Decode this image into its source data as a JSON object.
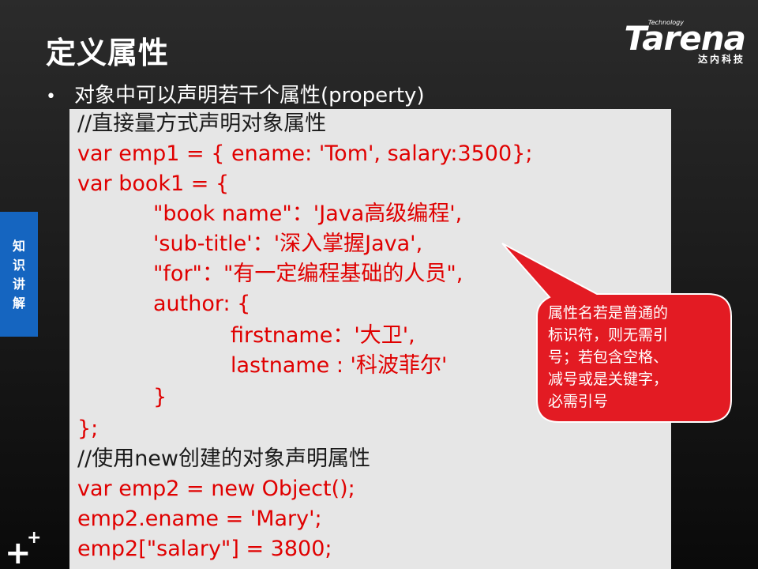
{
  "slide": {
    "title": "定义属性",
    "logo": {
      "tech": "Technology",
      "word": "Tarena",
      "cn": "达内科技"
    },
    "bullet": {
      "dot": "•",
      "text": "对象中可以声明若干个属性(property)"
    },
    "side_tab": [
      "知",
      "识",
      "讲",
      "解"
    ],
    "code_lines": [
      {
        "text": "//直接量方式声明对象属性",
        "kind": "comment"
      },
      {
        "text": "var emp1 = { ename: 'Tom',  salary:3500};",
        "kind": "code"
      },
      {
        "text": "var book1 = {",
        "kind": "code"
      },
      {
        "text": "\"book name\"：'Java高级编程',",
        "kind": "code"
      },
      {
        "text": "'sub-title'：'深入掌握Java',",
        "kind": "code"
      },
      {
        "text": "\"for\"：\"有一定编程基础的人员\",",
        "kind": "code"
      },
      {
        "text": "author: {",
        "kind": "code"
      },
      {
        "text": "firstname：'大卫',",
        "kind": "code"
      },
      {
        "text": "lastname : '科波菲尔'",
        "kind": "code"
      },
      {
        "text": "}",
        "kind": "code"
      },
      {
        "text": "};",
        "kind": "code"
      },
      {
        "text": "//使用new创建的对象声明属性",
        "kind": "comment"
      },
      {
        "text": "var emp2 = new Object();",
        "kind": "code"
      },
      {
        "text": "emp2.ename = 'Mary';",
        "kind": "code"
      },
      {
        "text": "emp2[\"salary\"] = 3800;",
        "kind": "code"
      }
    ],
    "callout": {
      "lines": [
        "属性名若是普通的",
        "标识符，则无需引",
        "号；若包含空格、",
        "减号或是关键字，",
        "必需引号"
      ],
      "color": "#e31b23"
    },
    "colors": {
      "code": "#e00000",
      "comment": "#1a1a1a",
      "code_bg": "#e6e6e6",
      "side_tab": "#1565c0"
    },
    "footer_icon": "plus-plus-icon"
  }
}
